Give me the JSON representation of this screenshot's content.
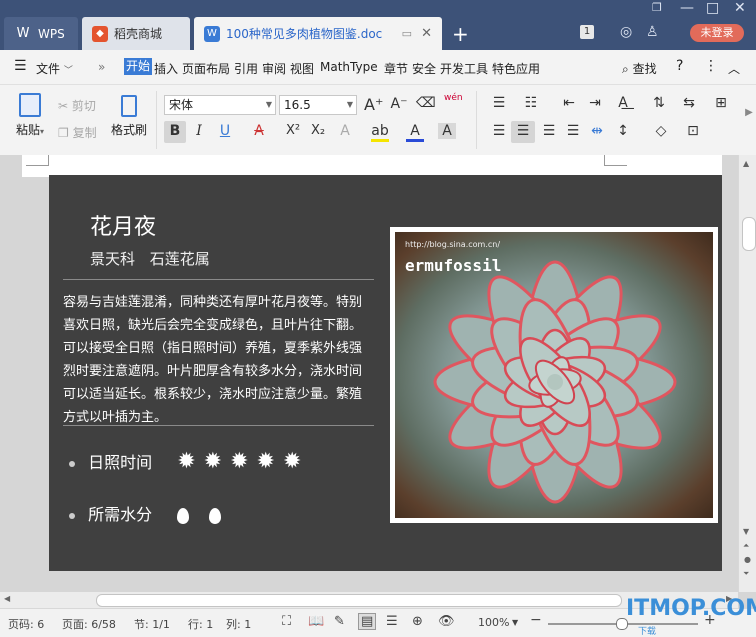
{
  "titlebar": {
    "tabs": [
      {
        "label": "WPS",
        "icon": "wps-logo-icon"
      },
      {
        "label": "稻壳商城",
        "icon": "docer-icon"
      },
      {
        "label": "100种常见多肉植物图鉴.doc",
        "icon": "doc-icon"
      }
    ],
    "badge_number": "1",
    "login_label": "未登录"
  },
  "menubar": {
    "file_label": "文件",
    "items": [
      "开始",
      "插入",
      "页面布局",
      "引用",
      "审阅",
      "视图",
      "MathType",
      "章节",
      "安全",
      "开发工具",
      "特色应用"
    ],
    "search_label": "查找"
  },
  "ribbon": {
    "paste_label": "粘贴",
    "cut_label": "剪切",
    "copy_label": "复制",
    "format_painter_label": "格式刷",
    "font_name": "宋体",
    "font_size": "16.5",
    "pinyin_label": "wén",
    "bold": "B",
    "italic": "I",
    "underline": "U",
    "strike": "A",
    "superscript": "X²",
    "subscript": "X₂",
    "font_color_letter": "A",
    "highlight_letter": "ab",
    "shading_letter": "A",
    "accent_color": "#3a7bd5"
  },
  "document": {
    "title": "花月夜",
    "subtitle": "景天科 石莲花属",
    "body": "容易与吉娃莲混淆，同种类还有厚叶花月夜等。特别喜欢日照，缺光后会完全变成绿色，且叶片往下翻。可以接受全日照（指日照时间）养殖，夏季紫外线强烈时要注意遮阴。叶片肥厚含有较多水分，浇水时间可以适当延长。根系较少，浇水时应注意少量。繁殖方式以叶插为主。",
    "sunlight_label": "日照时间",
    "sunlight_rating": 5,
    "water_label": "所需水分",
    "water_rating": 2,
    "photo_watermark_url": "http://blog.sina.com.cn/",
    "photo_watermark_name": "ermufossil"
  },
  "statusbar": {
    "page_no": "页码: 6",
    "page": "页面: 6/58",
    "section": "节: 1/1",
    "row": "行: 1",
    "col": "列: 1",
    "zoom": "100%"
  },
  "watermark": {
    "logo": "ITMOP.COM",
    "sub": "下载"
  }
}
